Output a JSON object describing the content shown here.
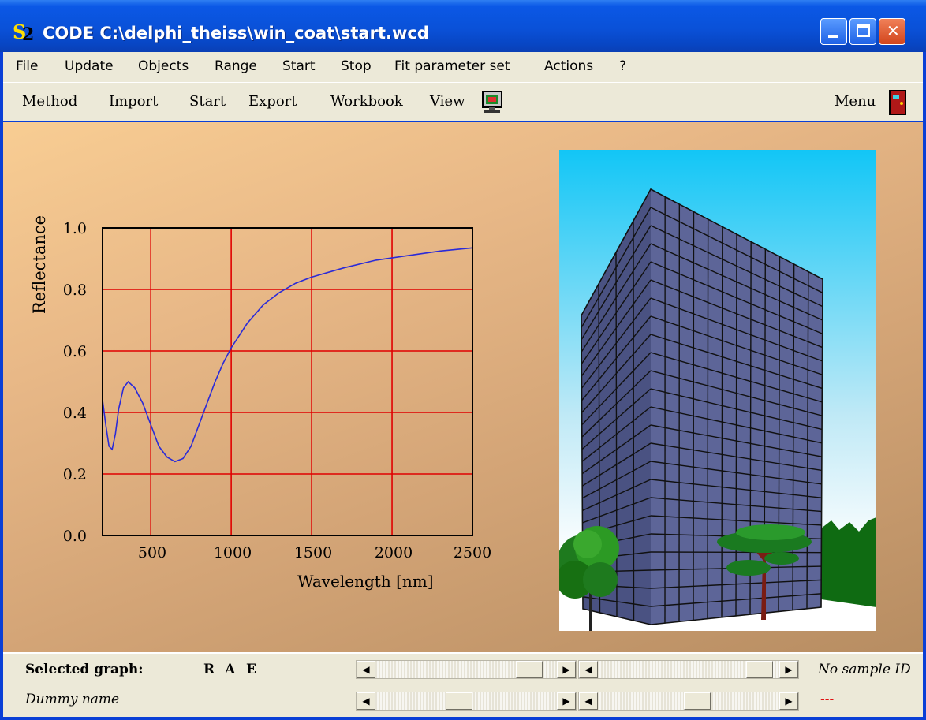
{
  "window": {
    "title": "CODE C:\\delphi_theiss\\win_coat\\start.wcd",
    "icon": "code-s2-icon",
    "controls": [
      "minimize-icon",
      "maximize-icon",
      "close-icon"
    ]
  },
  "menu": {
    "file": "File",
    "update": "Update",
    "objects": "Objects",
    "range": "Range",
    "start": "Start",
    "stop": "Stop",
    "fit_parameter_set": "Fit parameter set",
    "actions": "Actions",
    "help": "?"
  },
  "toolbar": {
    "method": "Method",
    "import": "Import",
    "start": "Start",
    "export": "Export",
    "workbook": "Workbook",
    "view": "View",
    "monitor_icon": "monitor-icon",
    "menu": "Menu",
    "exit_icon": "door-icon"
  },
  "chart_data": {
    "type": "line",
    "title": "",
    "xlabel": "Wavelength [nm]",
    "ylabel": "Reflectance",
    "xlim": [
      200,
      2500
    ],
    "ylim": [
      0.0,
      1.0
    ],
    "xticks": [
      "500",
      "1000",
      "1500",
      "2000",
      "2500"
    ],
    "yticks": [
      "0.0",
      "0.2",
      "0.4",
      "0.6",
      "0.8",
      "1.0"
    ],
    "grid": true,
    "series": [
      {
        "color": "#2a2ad8",
        "x": [
          200,
          220,
          240,
          260,
          280,
          300,
          330,
          360,
          400,
          450,
          500,
          550,
          600,
          650,
          700,
          750,
          800,
          850,
          900,
          950,
          1000,
          1100,
          1200,
          1300,
          1400,
          1500,
          1700,
          1900,
          2100,
          2300,
          2500
        ],
        "y": [
          0.44,
          0.36,
          0.29,
          0.28,
          0.33,
          0.41,
          0.48,
          0.5,
          0.48,
          0.43,
          0.36,
          0.29,
          0.255,
          0.24,
          0.25,
          0.29,
          0.36,
          0.43,
          0.5,
          0.56,
          0.61,
          0.69,
          0.75,
          0.79,
          0.82,
          0.84,
          0.87,
          0.895,
          0.91,
          0.925,
          0.935
        ]
      }
    ]
  },
  "illustration": {
    "scene": "building-with-trees",
    "sky_color": "#18c8f5",
    "facade_color": "#5c6496"
  },
  "status": {
    "selected_graph_label": "Selected graph:",
    "graph_r": "R",
    "graph_a": "A",
    "graph_e": "E",
    "dummy_name": "Dummy name",
    "sample_id": "No sample ID",
    "sample_value": "---",
    "scroll_1_level": 0.9,
    "scroll_2_level": 0.95,
    "scroll_3_level": 0.45,
    "scroll_4_level": 0.55
  }
}
